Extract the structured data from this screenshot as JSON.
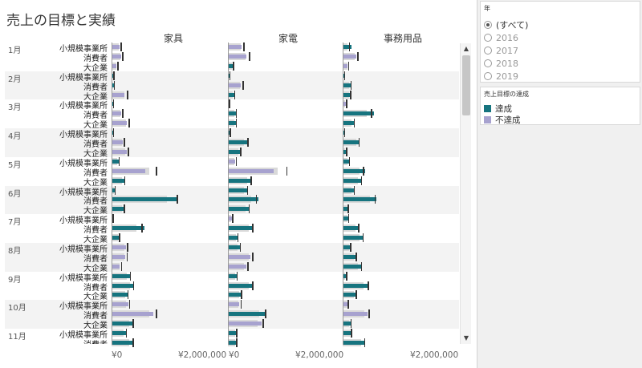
{
  "title": "売上の目標と実績",
  "columns": [
    "家具",
    "家電",
    "事務用品"
  ],
  "axis_label": "¥0",
  "axis_label_max": "¥2,000,000",
  "filter": {
    "title": "年",
    "options": [
      {
        "label": "(すべて)",
        "selected": true
      },
      {
        "label": "2016",
        "selected": false
      },
      {
        "label": "2017",
        "selected": false
      },
      {
        "label": "2018",
        "selected": false
      },
      {
        "label": "2019",
        "selected": false
      }
    ]
  },
  "legend": {
    "title": "売上目標の達成",
    "items": [
      {
        "label": "達成",
        "color": "#16747f"
      },
      {
        "label": "不達成",
        "color": "#a7a2cf"
      }
    ]
  },
  "colors": {
    "achieved": "#16747f",
    "missed": "#a7a2cf",
    "target_band": "#d9d9d9",
    "target_line": "#333333"
  },
  "chart_data": {
    "type": "bar",
    "title": "売上の目標と実績",
    "x_range": [
      0,
      2800000
    ],
    "panes": [
      "家具",
      "家電",
      "事務用品"
    ],
    "rows": [
      {
        "month": "1月",
        "segment": "小規模事業所",
        "values": [
          [
            200000,
            220000
          ],
          [
            340000,
            380000
          ],
          [
            210000,
            150000
          ]
        ]
      },
      {
        "month": "",
        "segment": "消費者",
        "values": [
          [
            230000,
            260000
          ],
          [
            460000,
            520000
          ],
          [
            330000,
            360000
          ]
        ]
      },
      {
        "month": "",
        "segment": "大企業",
        "values": [
          [
            110000,
            140000
          ],
          [
            130000,
            120000
          ],
          [
            120000,
            130000
          ]
        ]
      },
      {
        "month": "2月",
        "segment": "小規模事業所",
        "values": [
          [
            50000,
            40000
          ],
          [
            60000,
            30000
          ],
          [
            40000,
            30000
          ]
        ]
      },
      {
        "month": "",
        "segment": "消費者",
        "values": [
          [
            60000,
            50000
          ],
          [
            320000,
            360000
          ],
          [
            210000,
            190000
          ]
        ]
      },
      {
        "month": "",
        "segment": "大企業",
        "values": [
          [
            320000,
            380000
          ],
          [
            170000,
            150000
          ],
          [
            200000,
            180000
          ]
        ]
      },
      {
        "month": "3月",
        "segment": "小規模事業所",
        "values": [
          [
            40000,
            30000
          ],
          [
            30000,
            20000
          ],
          [
            70000,
            80000
          ]
        ]
      },
      {
        "month": "",
        "segment": "消費者",
        "values": [
          [
            240000,
            260000
          ],
          [
            200000,
            190000
          ],
          [
            780000,
            700000
          ]
        ]
      },
      {
        "month": "",
        "segment": "大企業",
        "values": [
          [
            380000,
            420000
          ],
          [
            190000,
            190000
          ],
          [
            290000,
            270000
          ]
        ]
      },
      {
        "month": "4月",
        "segment": "小規模事業所",
        "values": [
          [
            40000,
            30000
          ],
          [
            50000,
            40000
          ],
          [
            40000,
            30000
          ]
        ]
      },
      {
        "month": "",
        "segment": "消費者",
        "values": [
          [
            280000,
            300000
          ],
          [
            510000,
            480000
          ],
          [
            420000,
            390000
          ]
        ]
      },
      {
        "month": "",
        "segment": "大企業",
        "values": [
          [
            380000,
            400000
          ],
          [
            320000,
            300000
          ],
          [
            90000,
            80000
          ]
        ]
      },
      {
        "month": "5月",
        "segment": "小規模事業所",
        "values": [
          [
            180000,
            170000
          ],
          [
            180000,
            190000
          ],
          [
            160000,
            150000
          ]
        ]
      },
      {
        "month": "",
        "segment": "消費者",
        "values": [
          [
            840000,
            1100000
          ],
          [
            1130000,
            1450000
          ],
          [
            560000,
            500000
          ]
        ]
      },
      {
        "month": "",
        "segment": "大企業",
        "values": [
          [
            330000,
            310000
          ],
          [
            600000,
            560000
          ],
          [
            480000,
            450000
          ]
        ]
      },
      {
        "month": "6月",
        "segment": "小規模事業所",
        "values": [
          [
            80000,
            70000
          ],
          [
            500000,
            470000
          ],
          [
            300000,
            270000
          ]
        ]
      },
      {
        "month": "",
        "segment": "消費者",
        "values": [
          [
            1640000,
            1620000
          ],
          [
            750000,
            690000
          ],
          [
            830000,
            790000
          ]
        ]
      },
      {
        "month": "",
        "segment": "大企業",
        "values": [
          [
            320000,
            300000
          ],
          [
            540000,
            510000
          ],
          [
            130000,
            120000
          ]
        ]
      },
      {
        "month": "7月",
        "segment": "小規模事業所",
        "values": [
          [
            30000,
            20000
          ],
          [
            90000,
            100000
          ],
          [
            140000,
            130000
          ]
        ]
      },
      {
        "month": "",
        "segment": "消費者",
        "values": [
          [
            820000,
            740000
          ],
          [
            640000,
            600000
          ],
          [
            400000,
            380000
          ]
        ]
      },
      {
        "month": "",
        "segment": "大企業",
        "values": [
          [
            190000,
            180000
          ],
          [
            250000,
            230000
          ],
          [
            520000,
            490000
          ]
        ]
      },
      {
        "month": "8月",
        "segment": "小規模事業所",
        "values": [
          [
            350000,
            380000
          ],
          [
            310000,
            290000
          ],
          [
            200000,
            180000
          ]
        ]
      },
      {
        "month": "",
        "segment": "消費者",
        "values": [
          [
            330000,
            370000
          ],
          [
            560000,
            600000
          ],
          [
            350000,
            320000
          ]
        ]
      },
      {
        "month": "",
        "segment": "大企業",
        "values": [
          [
            200000,
            230000
          ],
          [
            450000,
            480000
          ],
          [
            470000,
            450000
          ]
        ]
      },
      {
        "month": "9月",
        "segment": "小規模事業所",
        "values": [
          [
            480000,
            450000
          ],
          [
            230000,
            210000
          ],
          [
            90000,
            80000
          ]
        ]
      },
      {
        "month": "",
        "segment": "消費者",
        "values": [
          [
            560000,
            530000
          ],
          [
            630000,
            600000
          ],
          [
            660000,
            620000
          ]
        ]
      },
      {
        "month": "",
        "segment": "大企業",
        "values": [
          [
            410000,
            390000
          ],
          [
            340000,
            320000
          ],
          [
            340000,
            320000
          ]
        ]
      },
      {
        "month": "10月",
        "segment": "小規模事業所",
        "values": [
          [
            410000,
            430000
          ],
          [
            280000,
            310000
          ],
          [
            110000,
            120000
          ]
        ]
      },
      {
        "month": "",
        "segment": "消費者",
        "values": [
          [
            1040000,
            1100000
          ],
          [
            930000,
            920000
          ],
          [
            620000,
            640000
          ]
        ]
      },
      {
        "month": "",
        "segment": "大企業",
        "values": [
          [
            550000,
            520000
          ],
          [
            840000,
            860000
          ],
          [
            210000,
            190000
          ]
        ]
      },
      {
        "month": "11月",
        "segment": "小規模事業所",
        "values": [
          [
            360000,
            350000
          ],
          [
            220000,
            200000
          ],
          [
            220000,
            200000
          ]
        ]
      },
      {
        "month": "",
        "segment": "消費者",
        "values": [
          [
            550000,
            520000
          ],
          [
            210000,
            200000
          ],
          [
            560000,
            530000
          ]
        ]
      }
    ]
  }
}
